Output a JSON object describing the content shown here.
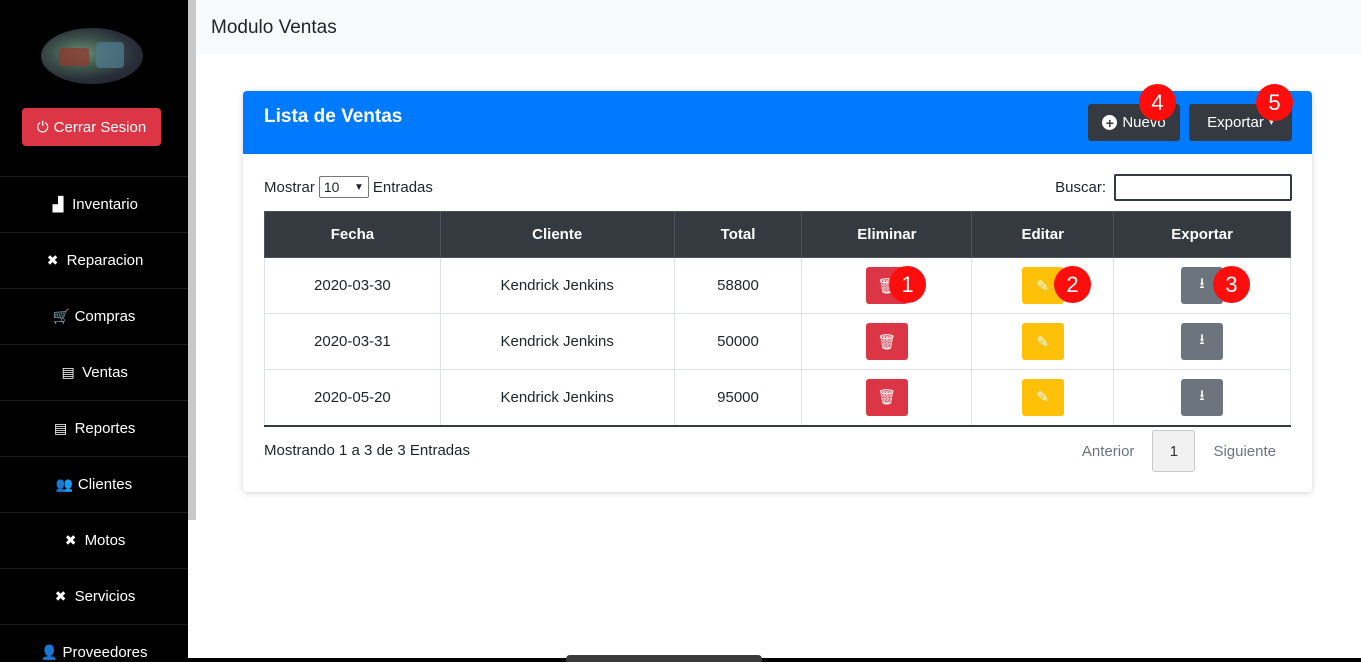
{
  "sidebar": {
    "logout_label": "Cerrar Sesion",
    "items": [
      {
        "label": "Inventario",
        "icon": "warehouse-icon",
        "glyph": "▟"
      },
      {
        "label": "Reparacion",
        "icon": "tools-icon",
        "glyph": "✖"
      },
      {
        "label": "Compras",
        "icon": "cart-icon",
        "glyph": "🛒"
      },
      {
        "label": "Ventas",
        "icon": "cash-register-icon",
        "glyph": "▤"
      },
      {
        "label": "Reportes",
        "icon": "cash-register-icon",
        "glyph": "▤"
      },
      {
        "label": "Clientes",
        "icon": "users-icon",
        "glyph": "👥"
      },
      {
        "label": "Motos",
        "icon": "tools-icon",
        "glyph": "✖"
      },
      {
        "label": "Servicios",
        "icon": "tools-icon",
        "glyph": "✖"
      },
      {
        "label": "Proveedores",
        "icon": "user-tie-icon",
        "glyph": "👤"
      }
    ]
  },
  "header": {
    "title": "Modulo Ventas"
  },
  "card": {
    "title": "Lista de Ventas",
    "new_label": "Nuevo",
    "export_label": "Exportar",
    "length_prefix": "Mostrar",
    "length_value": "10",
    "length_suffix": "Entradas",
    "search_label": "Buscar:",
    "search_value": "",
    "columns": [
      "Fecha",
      "Cliente",
      "Total",
      "Eliminar",
      "Editar",
      "Exportar"
    ],
    "rows": [
      {
        "fecha": "2020-03-30",
        "cliente": "Kendrick Jenkins",
        "total": "58800"
      },
      {
        "fecha": "2020-03-31",
        "cliente": "Kendrick Jenkins",
        "total": "50000"
      },
      {
        "fecha": "2020-05-20",
        "cliente": "Kendrick Jenkins",
        "total": "95000"
      }
    ],
    "info": "Mostrando 1 a 3 de 3 Entradas",
    "prev_label": "Anterior",
    "current_page": "1",
    "next_label": "Siguiente"
  },
  "annotations": [
    "1",
    "2",
    "3",
    "4",
    "5"
  ],
  "colors": {
    "primary": "#007bff",
    "danger": "#dc3545",
    "warning": "#ffc107",
    "secondary": "#6c757d",
    "dark": "#343a40",
    "badge": "#ff0d0d"
  }
}
